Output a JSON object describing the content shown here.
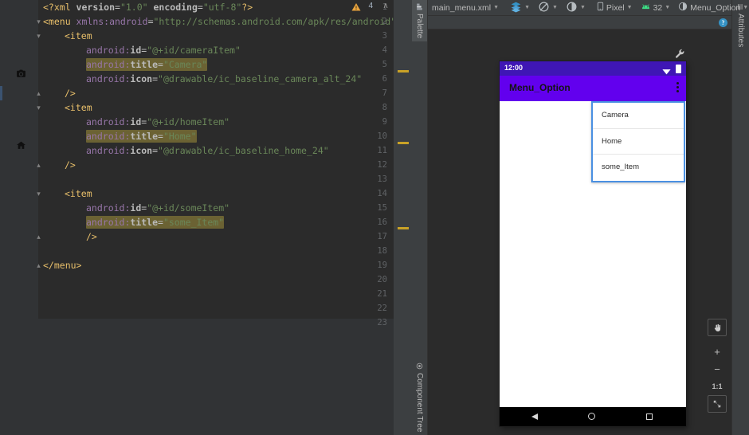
{
  "editor": {
    "warning_count": "4",
    "warning_icon": "warning-triangle-icon",
    "prev_chevron": "∧",
    "next_chevron": "∨",
    "last_line_number": "23",
    "lines": [
      {
        "n": "1",
        "indent": 0,
        "text": "<?xml version=\"1.0\" encoding=\"utf-8\"?>"
      },
      {
        "n": "2",
        "indent": 0,
        "text": "<menu xmlns:android=\"http://schemas.android.com/apk/res/android\">"
      },
      {
        "n": "3",
        "indent": 1,
        "text": "<item"
      },
      {
        "n": "4",
        "indent": 2,
        "text": "android:id=\"@+id/cameraItem\""
      },
      {
        "n": "5",
        "indent": 2,
        "text": "android:title=\"Camera\""
      },
      {
        "n": "6",
        "indent": 2,
        "text": "android:icon=\"@drawable/ic_baseline_camera_alt_24\""
      },
      {
        "n": "7",
        "indent": 1,
        "text": "/>"
      },
      {
        "n": "8",
        "indent": 1,
        "text": "<item"
      },
      {
        "n": "9",
        "indent": 2,
        "text": "android:id=\"@+id/homeItem\""
      },
      {
        "n": "10",
        "indent": 2,
        "text": "android:title=\"Home\""
      },
      {
        "n": "11",
        "indent": 2,
        "text": "android:icon=\"@drawable/ic_baseline_home_24\""
      },
      {
        "n": "12",
        "indent": 1,
        "text": "/>"
      },
      {
        "n": "13",
        "indent": 0,
        "text": ""
      },
      {
        "n": "14",
        "indent": 1,
        "text": "<item"
      },
      {
        "n": "15",
        "indent": 2,
        "text": "android:id=\"@+id/someItem\""
      },
      {
        "n": "16",
        "indent": 2,
        "text": "android:title=\"some_Item\""
      },
      {
        "n": "17",
        "indent": 2,
        "text": "/>"
      },
      {
        "n": "18",
        "indent": 0,
        "text": ""
      },
      {
        "n": "19",
        "indent": 0,
        "text": "</menu>"
      },
      {
        "n": "20",
        "indent": 0,
        "text": ""
      },
      {
        "n": "21",
        "indent": 0,
        "text": ""
      },
      {
        "n": "22",
        "indent": 0,
        "text": ""
      },
      {
        "n": "23",
        "indent": 0,
        "text": ""
      }
    ],
    "gutter_icons": [
      {
        "line": "6",
        "name": "camera-icon"
      },
      {
        "line": "11",
        "name": "home-icon"
      }
    ]
  },
  "design": {
    "left_tabs": [
      {
        "label": "Palette",
        "icon": "palette-icon"
      },
      {
        "label": "Component Tree",
        "icon": "component-tree-icon"
      }
    ],
    "right_tabs": [
      {
        "label": "Attributes",
        "icon": "attributes-icon"
      }
    ],
    "toolbar": {
      "file_name": "main_menu.xml",
      "layers_icon": "layers-icon",
      "blueprint_icon": "blueprint-toggle-icon",
      "theme_icon": "color-blind-mode-icon",
      "device_icon": "phone-icon",
      "device": "Pixel",
      "api_icon": "android-icon",
      "api_level": "32",
      "theme_select_icon": "theme-icon",
      "theme": "Menu_Option",
      "overflow": "»",
      "warning_icon": "warning-triangle-icon"
    },
    "subbar": {
      "help_icon": "help-icon",
      "help_glyph": "?"
    },
    "wrench_icon": "wrench-icon",
    "zoom_controls": {
      "pan_icon": "pan-hand-icon",
      "zoom_in": "+",
      "zoom_out": "−",
      "actual_size": "1:1",
      "fit_icon": "zoom-to-fit-icon"
    }
  },
  "preview": {
    "status_bar": {
      "time": "12:00",
      "wifi_icon": "wifi-icon",
      "battery_icon": "battery-icon"
    },
    "app_bar": {
      "title": "Menu_Option",
      "overflow_icon": "overflow-menu-icon"
    },
    "menu_items": [
      {
        "label": "Camera"
      },
      {
        "label": "Home"
      },
      {
        "label": "some_Item"
      }
    ],
    "nav_bar": {
      "back_icon": "nav-back-icon",
      "home_icon": "nav-home-icon",
      "recents_icon": "nav-recents-icon"
    }
  },
  "colors": {
    "accent_purple": "#6200ee",
    "status_purple": "#3f16b5",
    "selection_blue": "#4a90e2",
    "warning_yellow": "#c9a227",
    "highlight_olive": "#6b6233"
  }
}
